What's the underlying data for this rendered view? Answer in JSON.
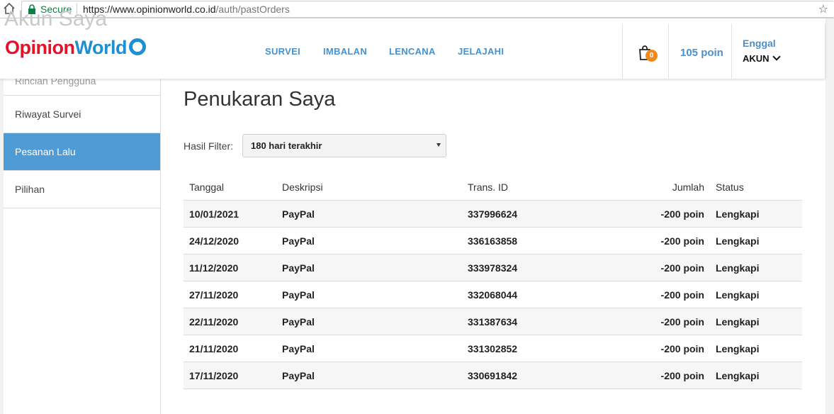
{
  "browser": {
    "secure_label": "Secure",
    "url_host": "https://www.opinionworld.co.id",
    "url_path": "/auth/pastOrders"
  },
  "sidebar": {
    "ghost_title": "Akun Saya",
    "items": [
      {
        "label": "Rincian Pengguna"
      },
      {
        "label": "Riwayat Survei"
      },
      {
        "label": "Pesanan Lalu"
      },
      {
        "label": "Pilihan"
      }
    ]
  },
  "header": {
    "logo_part1": "Opinion",
    "logo_part2": "World",
    "nav": [
      {
        "label": "SURVEI"
      },
      {
        "label": "IMBALAN"
      },
      {
        "label": "LENCANA"
      },
      {
        "label": "JELAJAHI"
      }
    ],
    "cart_count": "0",
    "points": "105 poin",
    "user_name": "Enggal",
    "account_label": "AKUN"
  },
  "main": {
    "title": "Penukaran Saya",
    "filter_label": "Hasil Filter:",
    "filter_value": "180 hari terakhir",
    "columns": {
      "date": "Tanggal",
      "desc": "Deskripsi",
      "trans": "Trans. ID",
      "amount": "Jumlah",
      "status": "Status"
    },
    "rows": [
      {
        "date": "10/01/2021",
        "desc": "PayPal",
        "trans": "337996624",
        "amount": "-200 poin",
        "status": "Lengkapi"
      },
      {
        "date": "24/12/2020",
        "desc": "PayPal",
        "trans": "336163858",
        "amount": "-200 poin",
        "status": "Lengkapi"
      },
      {
        "date": "11/12/2020",
        "desc": "PayPal",
        "trans": "333978324",
        "amount": "-200 poin",
        "status": "Lengkapi"
      },
      {
        "date": "27/11/2020",
        "desc": "PayPal",
        "trans": "332068044",
        "amount": "-200 poin",
        "status": "Lengkapi"
      },
      {
        "date": "22/11/2020",
        "desc": "PayPal",
        "trans": "331387634",
        "amount": "-200 poin",
        "status": "Lengkapi"
      },
      {
        "date": "21/11/2020",
        "desc": "PayPal",
        "trans": "331302852",
        "amount": "-200 poin",
        "status": "Lengkapi"
      },
      {
        "date": "17/11/2020",
        "desc": "PayPal",
        "trans": "330691842",
        "amount": "-200 poin",
        "status": "Lengkapi"
      }
    ]
  }
}
